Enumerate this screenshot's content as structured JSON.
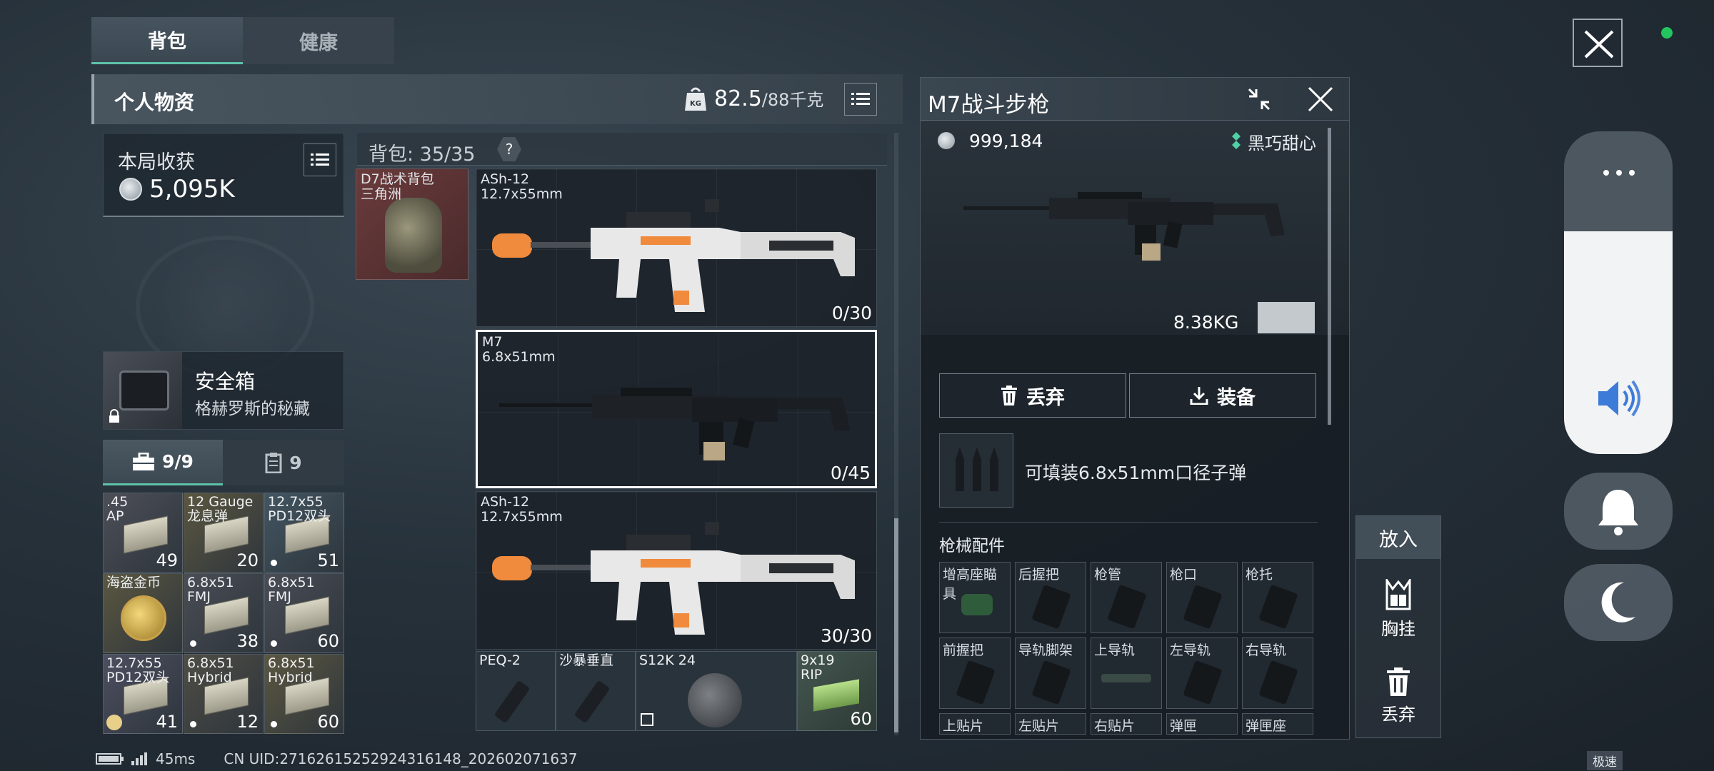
{
  "tabs": [
    {
      "label": "背包",
      "active": true
    },
    {
      "label": "健康",
      "active": false
    }
  ],
  "personal": {
    "title": "个人物资",
    "weight_current": "82.5",
    "weight_max": "/88千克"
  },
  "session_loot": {
    "label": "本局收获",
    "value": "5,095K"
  },
  "backpack": {
    "capacity_label": "背包: 35/35",
    "help": "?",
    "bag_item_name": "D7战术背包\n三角洲"
  },
  "safe_box": {
    "title": "安全箱",
    "subtitle": "格赫罗斯的秘藏"
  },
  "sub_tabs": [
    {
      "label": "9/9",
      "icon": "toolbox-icon",
      "active": true
    },
    {
      "label": "9",
      "icon": "clipboard-icon",
      "active": false
    }
  ],
  "safe_items": [
    {
      "name": ".45\nAP",
      "qty": "49",
      "dot": false,
      "color": "#4d4f58"
    },
    {
      "name": "12 Gauge\n龙息弹",
      "qty": "20",
      "dot": false,
      "color": "#5b5740"
    },
    {
      "name": "12.7x55\nPD12双头",
      "qty": "51",
      "dot": true,
      "color": "#435662"
    },
    {
      "name": "海盗金币",
      "qty": "",
      "dot": false,
      "color": "#5b5740"
    },
    {
      "name": "6.8x51\nFMJ",
      "qty": "38",
      "dot": true,
      "color": "#4a4d55"
    },
    {
      "name": "6.8x51\nFMJ",
      "qty": "60",
      "dot": true,
      "color": "#4a4d55"
    },
    {
      "name": "12.7x55\nPD12双头",
      "qty": "41",
      "dot": false,
      "color": "#4d4f60"
    },
    {
      "name": "6.8x51\nHybrid",
      "qty": "12",
      "dot": true,
      "color": "#4f4d45"
    },
    {
      "name": "6.8x51\nHybrid",
      "qty": "60",
      "dot": true,
      "color": "#5b5740"
    }
  ],
  "guns": [
    {
      "name": "ASh-12\n12.7x55mm",
      "ammo": "0/30",
      "style": "white"
    },
    {
      "name": "M7\n6.8x51mm",
      "ammo": "0/45",
      "style": "black",
      "selected": true
    },
    {
      "name": "ASh-12\n12.7x55mm",
      "ammo": "30/30",
      "style": "white"
    }
  ],
  "bottom_items": [
    {
      "name": "PEQ-2",
      "qty": ""
    },
    {
      "name": "沙暴垂直",
      "qty": ""
    },
    {
      "name": "S12K 24",
      "qty": ""
    },
    {
      "name": "9x19\nRIP",
      "qty": "60"
    }
  ],
  "detail": {
    "title": "M7战斗步枪",
    "price": "999,184",
    "rarity": "黑巧甜心",
    "weight": "8.38KG",
    "discard": "丢弃",
    "equip": "装备",
    "ammo_desc": "可填装6.8x51mm口径子弹",
    "attachments_title": "枪械配件",
    "attachments": [
      "增高座瞄具",
      "后握把",
      "枪管",
      "枪口",
      "枪托",
      "前握把",
      "导轨脚架",
      "上导轨",
      "左导轨",
      "右导轨",
      "上贴片",
      "左贴片",
      "右贴片",
      "弹匣",
      "弹匣座"
    ]
  },
  "side_actions": {
    "title": "放入",
    "chest": "胸挂",
    "discard": "丢弃"
  },
  "status": {
    "ping": "45ms",
    "uid": "CN UID:27162615252924316148_202602071637",
    "speed": "极速"
  },
  "colors": {
    "accent": "#5fc2a8",
    "rarity": "#4fd1a5",
    "volume_icon": "#3d7bd9",
    "online_dot": "#22c55e"
  }
}
